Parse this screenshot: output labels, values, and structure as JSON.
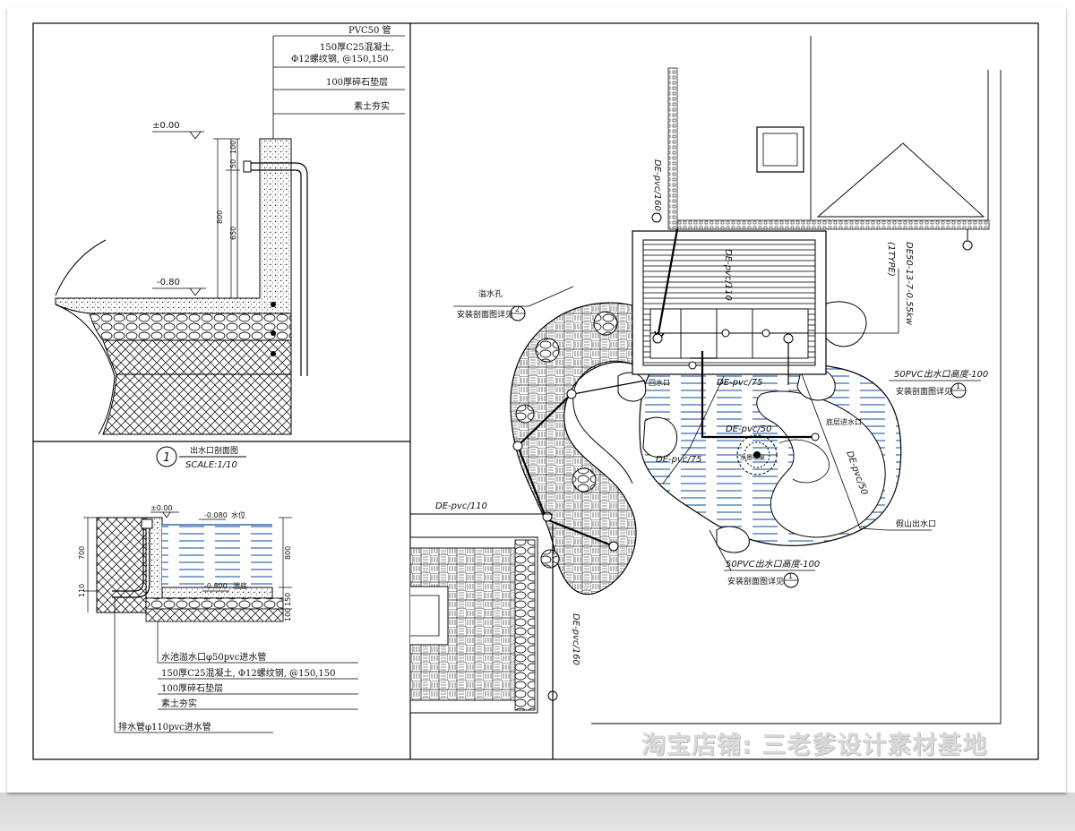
{
  "left_top_section": {
    "label_pvc_pipe": "PVC50 管",
    "label_concrete_1": "150厚C25混凝土,",
    "label_concrete_2": "Φ12螺纹钢, @150,150",
    "label_gravel": "100厚碎石垫层",
    "label_soil": "素土夯实",
    "level_zero": "±0.00",
    "level_minus": "-0.80",
    "dim_800": "800",
    "dim_650": "650",
    "dim_50": "50",
    "dim_100": "100",
    "title_number": "1",
    "title_text": "出水口剖面图",
    "scale_text": "SCALE:1/10"
  },
  "left_bottom_section": {
    "level_zero": "±0.00",
    "level_water": "-0.080",
    "water_label": "水位",
    "level_bottom": "-0.800",
    "bottom_label": "池底",
    "dim_700": "700",
    "dim_110": "110",
    "dim_800": "800",
    "dim_150": "150",
    "dim_100": "100",
    "label_inlet": "水池溢水口φ50pvc进水管",
    "label_concrete": "150厚C25混凝土, Φ12螺纹钢, @150,150",
    "label_gravel": "100厚碎石垫层",
    "label_soil": "素土夯实",
    "label_drain": "排水管φ110pvc进水管"
  },
  "plan": {
    "pipe_de160_top": "DE-pvc/160",
    "pipe_de160_bottom": "DE-pvc/160",
    "pipe_de110_left": "DE-pvc/110",
    "pipe_de110_mid": "DE-pvc/110",
    "pipe_de75_a": "DE-pvc/75",
    "pipe_de75_b": "DE-pvc/75",
    "pipe_de50_a": "DE-pvc/50",
    "pipe_de50_b": "DE-pvc/50",
    "pump_label_1": "DE50-13-7-0.55kw",
    "pump_label_2": "(1TYPE)",
    "overflow_label": "溢水孔",
    "detail_ref": "安装剖面图详见",
    "detail_num_2": "2",
    "detail_num_1": "1",
    "outlet_label_1": "50PVC出水口高度-100",
    "outlet_label_2": "50PVC出水口高度-100",
    "inlet_label": "底层进水口",
    "inlet_label_2": "回水口",
    "fountain_label": "水景喷泉",
    "rockery_label": "假山出水口"
  },
  "watermark": "淘宝店铺: 三老爹设计素材基地"
}
